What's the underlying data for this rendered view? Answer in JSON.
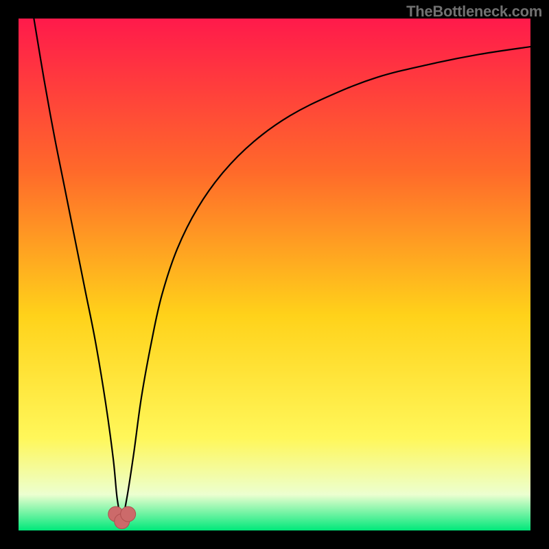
{
  "watermark": "TheBottleneck.com",
  "colors": {
    "frame": "#000000",
    "gradient_top": "#ff1a4b",
    "gradient_mid_upper": "#ff6a2a",
    "gradient_mid": "#ffd21a",
    "gradient_lower": "#fff75a",
    "gradient_pale": "#ecffd0",
    "gradient_bottom": "#00e87a",
    "curve": "#000000",
    "marker_fill": "#cc6a6a",
    "marker_stroke": "#b04f4f"
  },
  "chart_data": {
    "type": "line",
    "title": "",
    "xlabel": "",
    "ylabel": "",
    "xlim": [
      0,
      100
    ],
    "ylim": [
      0,
      100
    ],
    "series": [
      {
        "name": "bottleneck-curve",
        "x": [
          3,
          5,
          7,
          9,
          11,
          13,
          15,
          17,
          18.5,
          19.3,
          20.2,
          21.1,
          22.5,
          24,
          26,
          28,
          31,
          35,
          40,
          46,
          53,
          61,
          70,
          80,
          90,
          100
        ],
        "values": [
          100,
          88,
          77,
          67,
          57,
          47,
          37,
          25,
          14,
          6,
          2.5,
          6,
          15,
          26,
          37,
          46,
          55,
          63,
          70,
          76,
          81,
          85,
          88.5,
          91,
          93,
          94.5
        ]
      }
    ],
    "markers": [
      {
        "name": "valley-marker-left",
        "x": 19.0,
        "y": 3.2
      },
      {
        "name": "valley-marker-mid",
        "x": 20.2,
        "y": 1.8
      },
      {
        "name": "valley-marker-right",
        "x": 21.4,
        "y": 3.2
      }
    ]
  }
}
